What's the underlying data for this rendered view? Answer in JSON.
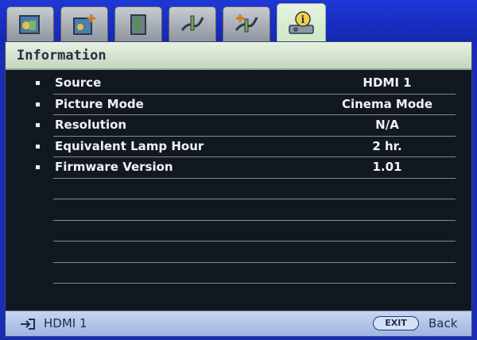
{
  "tabs": [
    {
      "icon": "picture-icon"
    },
    {
      "icon": "picture-advanced-icon"
    },
    {
      "icon": "display-icon"
    },
    {
      "icon": "settings-basic-icon"
    },
    {
      "icon": "settings-advanced-icon"
    },
    {
      "icon": "information-icon",
      "active": true
    }
  ],
  "header": {
    "title": "Information"
  },
  "rows": [
    {
      "label": "Source",
      "value": "HDMI 1"
    },
    {
      "label": "Picture Mode",
      "value": "Cinema Mode"
    },
    {
      "label": "Resolution",
      "value": "N/A"
    },
    {
      "label": "Equivalent Lamp Hour",
      "value": "2 hr."
    },
    {
      "label": "Firmware Version",
      "value": "1.01"
    }
  ],
  "footer": {
    "source": "HDMI 1",
    "exit_label": "EXIT",
    "back_label": "Back"
  },
  "colors": {
    "background": "#1a2bb8",
    "panel": "#121821",
    "header": "#dbe9d6",
    "footer": "#b6c8ee"
  }
}
